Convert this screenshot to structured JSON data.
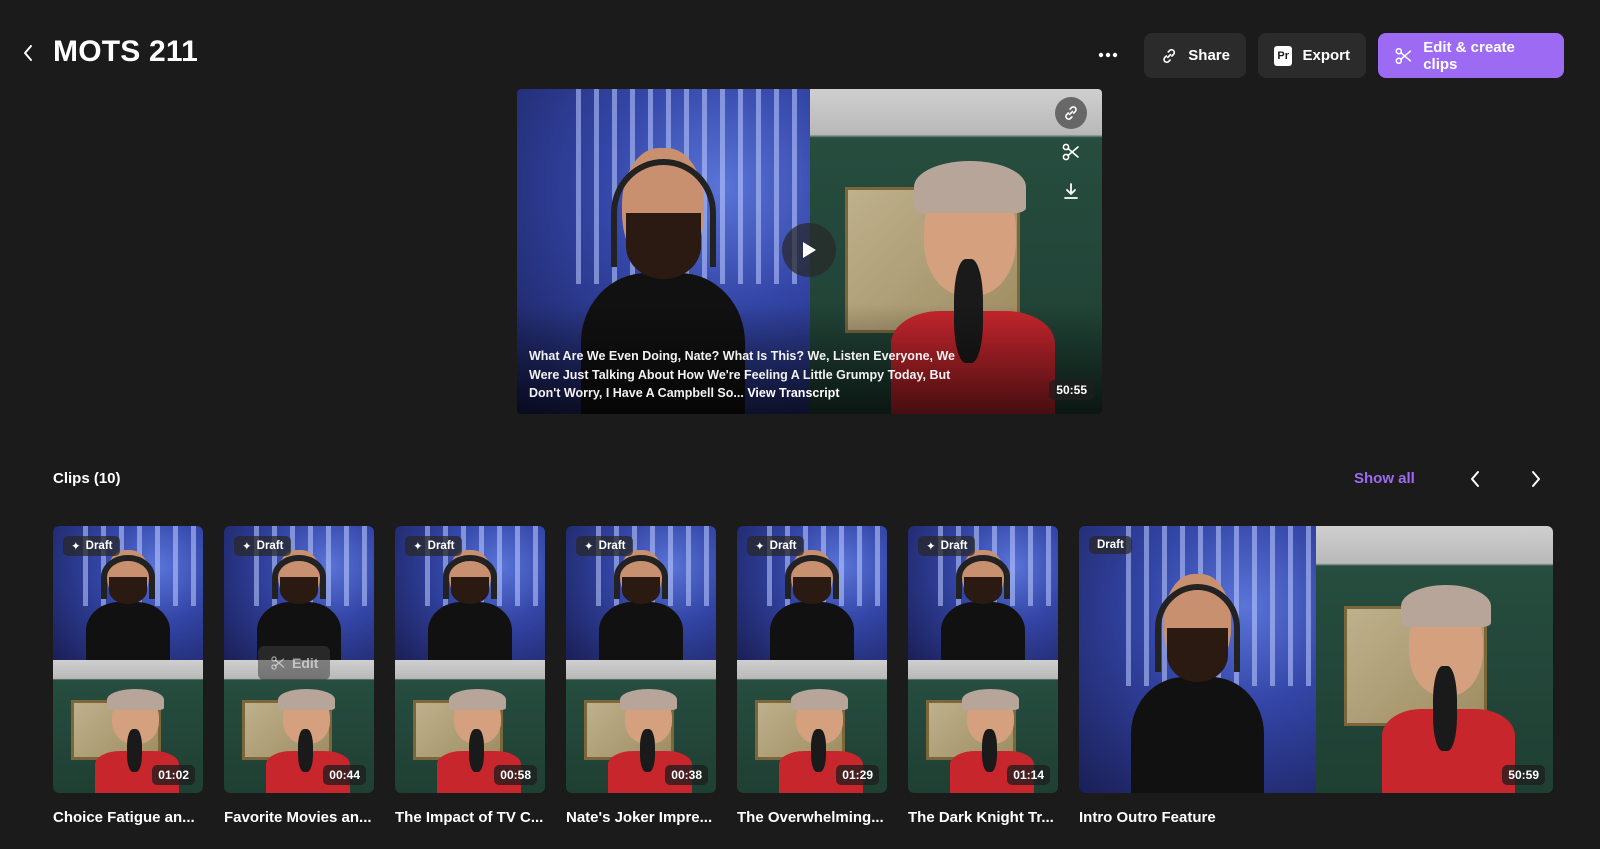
{
  "header": {
    "back_icon": "chevron-left-icon",
    "title": "MOTS 211",
    "more_icon": "ellipsis-icon",
    "share_label": "Share",
    "export_label": "Export",
    "export_icon_text": "Pr",
    "primary_label": "Edit & create clips",
    "primary_color": "#9d6bf3"
  },
  "player": {
    "transcript": "What Are We Even Doing, Nate? What Is This? We, Listen Everyone, We Were Just Talking About How We're Feeling A Little Grumpy Today, But Don't Worry, I Have A Campbell So...",
    "view_transcript_label": "View Transcript",
    "duration": "50:55",
    "tools": [
      "link-icon",
      "scissors-icon",
      "download-icon"
    ]
  },
  "clips": {
    "heading": "Clips (10)",
    "show_all_label": "Show all",
    "items": [
      {
        "title": "Choice Fatigue an...",
        "duration": "01:02",
        "badge": "Draft"
      },
      {
        "title": "Favorite Movies an...",
        "duration": "00:44",
        "badge": "Draft",
        "hover_label": "Edit"
      },
      {
        "title": "The Impact of TV C...",
        "duration": "00:58",
        "badge": "Draft"
      },
      {
        "title": "Nate's Joker Impre...",
        "duration": "00:38",
        "badge": "Draft"
      },
      {
        "title": "The Overwhelming...",
        "duration": "01:29",
        "badge": "Draft"
      },
      {
        "title": "The Dark Knight Tr...",
        "duration": "01:14",
        "badge": "Draft"
      },
      {
        "title": "Intro Outro Feature",
        "duration": "50:59",
        "badge": "Draft"
      }
    ]
  }
}
